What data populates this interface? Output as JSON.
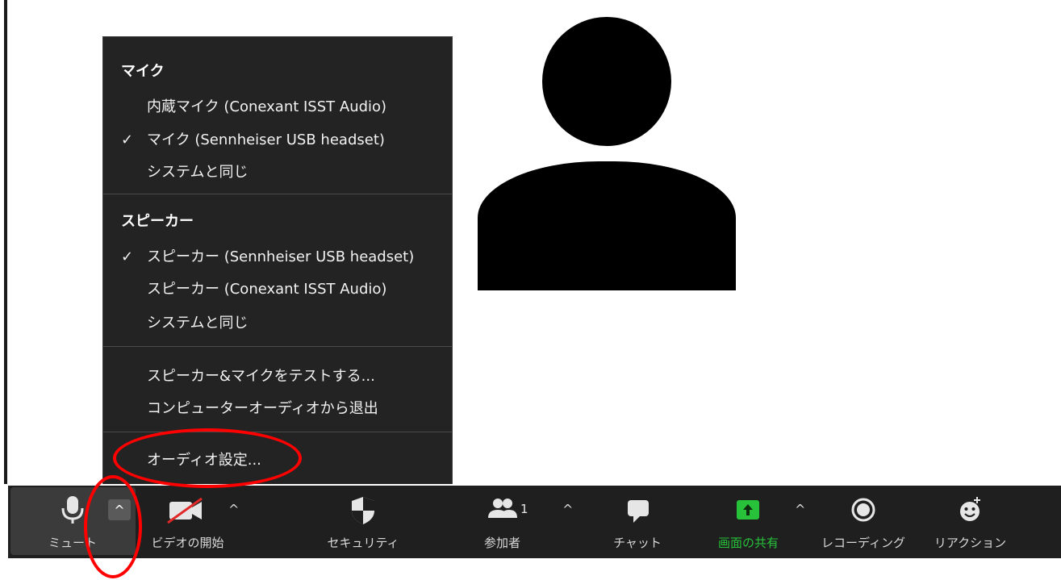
{
  "audio_menu": {
    "mic_heading": "マイク",
    "mic_options": [
      {
        "label": "内蔵マイク (Conexant ISST Audio)",
        "checked": false
      },
      {
        "label": "マイク (Sennheiser USB headset)",
        "checked": true
      },
      {
        "label": "システムと同じ",
        "checked": false
      }
    ],
    "speaker_heading": "スピーカー",
    "speaker_options": [
      {
        "label": "スピーカー (Sennheiser USB headset)",
        "checked": true
      },
      {
        "label": "スピーカー (Conexant ISST Audio)",
        "checked": false
      },
      {
        "label": "システムと同じ",
        "checked": false
      }
    ],
    "test_label": "スピーカー&マイクをテストする...",
    "leave_label": "コンピューターオーディオから退出",
    "settings_label": "オーディオ設定...",
    "check_mark": "✓"
  },
  "toolbar": {
    "mute_label": "ミュート",
    "audio_caret": "^",
    "video_label": "ビデオの開始",
    "video_caret": "^",
    "security_label": "セキュリティ",
    "participants_label": "参加者",
    "participants_count": "1",
    "participants_caret": "^",
    "chat_label": "チャット",
    "share_label": "画面の共有",
    "share_caret": "^",
    "record_label": "レコーディング",
    "reactions_label": "リアクション"
  },
  "colors": {
    "toolbar_bg": "#1f1f1f",
    "menu_bg": "#232323",
    "share_green": "#27c23a",
    "annotation_red": "#ff0000",
    "video_off_red": "#e02828"
  }
}
